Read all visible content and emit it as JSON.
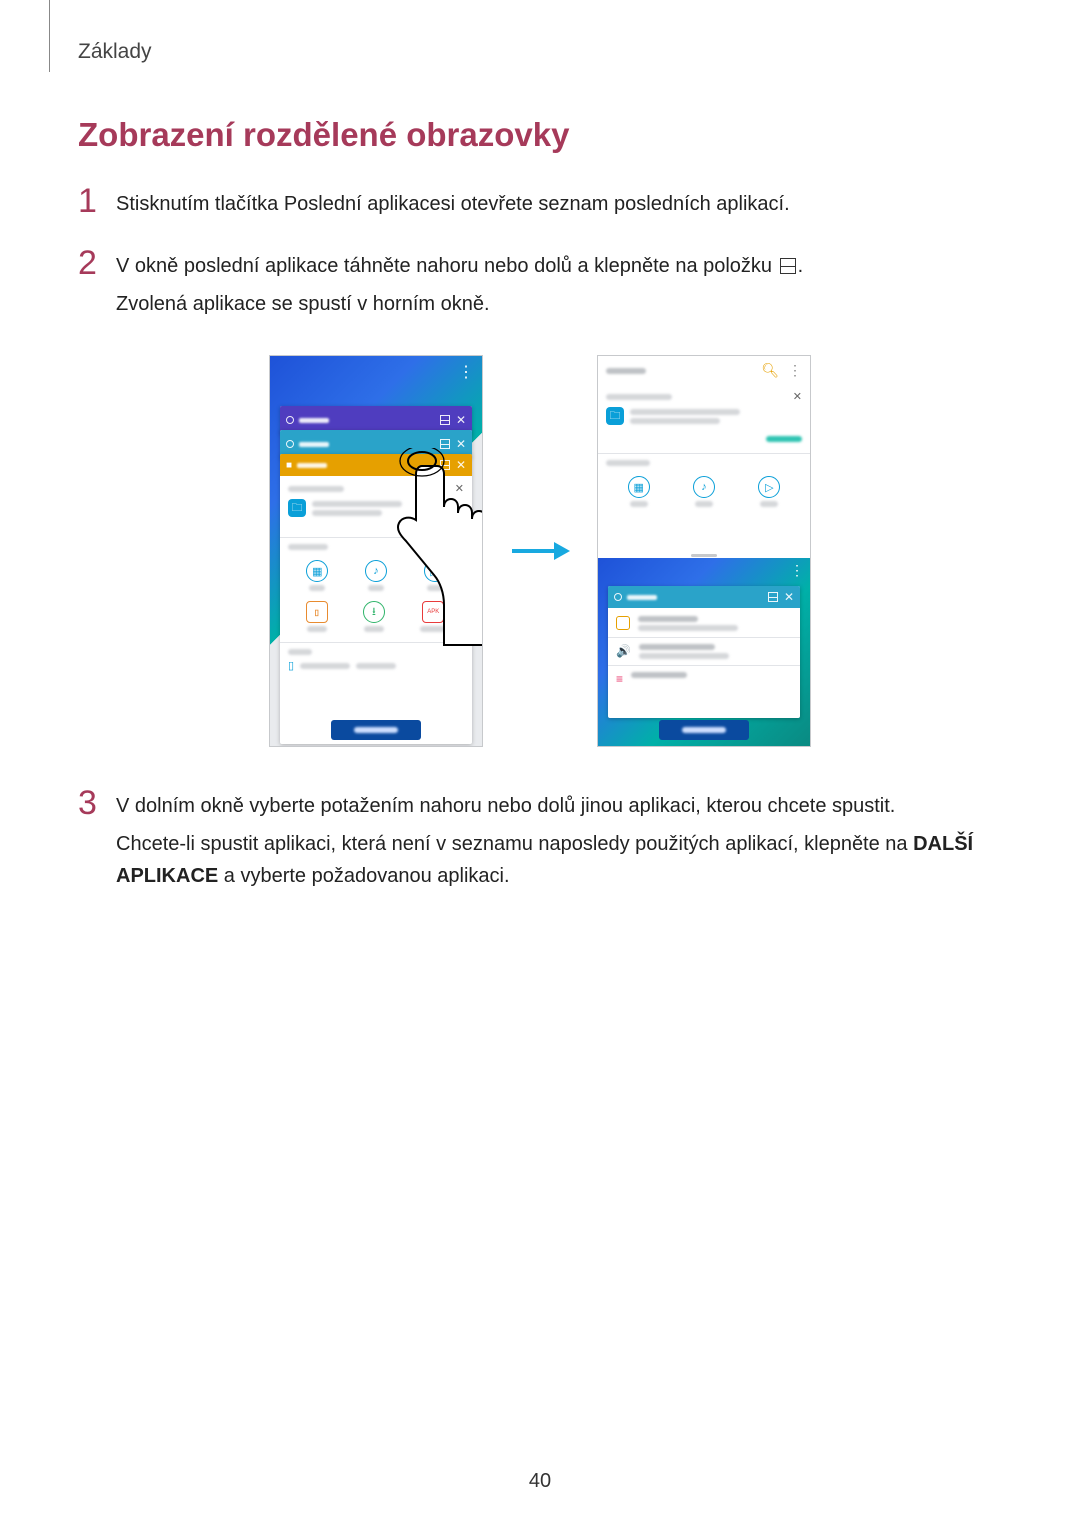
{
  "breadcrumb": "Základy",
  "section_title": "Zobrazení rozdělené obrazovky",
  "steps": {
    "s1": {
      "num": "1",
      "text": "Stisknutím tlačítka Poslední aplikacesi otevřete seznam posledních aplikací."
    },
    "s2": {
      "num": "2",
      "line1_a": "V okně poslední aplikace táhněte nahoru nebo dolů a klepněte na položku ",
      "line1_b": ".",
      "line2": "Zvolená aplikace se spustí v horním okně."
    },
    "s3": {
      "num": "3",
      "line1": "V dolním okně vyberte potažením nahoru nebo dolů jinou aplikaci, kterou chcete spustit.",
      "line2_a": "Chcete-li spustit aplikaci, která není v seznamu naposledy použitých aplikací, klepněte na ",
      "line2_bold": "DALŠÍ APLIKACE",
      "line2_b": " a vyberte požadovanou aplikaci."
    }
  },
  "page_number": "40",
  "figure": {
    "left_phone": {
      "top_app_colors": [
        "#4f3dbf",
        "#2aa3c9",
        "#e6a000"
      ],
      "close_all_color": "#0a4a9f"
    },
    "right_phone": {
      "search_icon": "search",
      "more_icon": "more",
      "bottom_header_color": "#2aa3c9"
    }
  }
}
